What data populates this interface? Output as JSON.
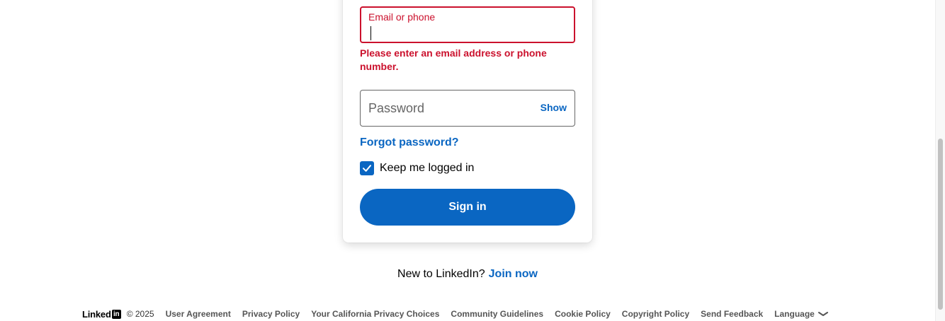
{
  "login_form": {
    "email_label": "Email or phone",
    "email_value": "",
    "email_error": "Please enter an email address or phone number.",
    "password_placeholder": "Password",
    "show_label": "Show",
    "forgot_password": "Forgot password?",
    "keep_logged_in_label": "Keep me logged in",
    "keep_logged_in_checked": true,
    "sign_in_label": "Sign in"
  },
  "join": {
    "prompt": "New to LinkedIn?",
    "link": "Join now"
  },
  "footer": {
    "logo_text": "Linked",
    "logo_badge": "in",
    "copyright": "© 2025",
    "links": [
      "User Agreement",
      "Privacy Policy",
      "Your California Privacy Choices",
      "Community Guidelines",
      "Cookie Policy",
      "Copyright Policy",
      "Send Feedback"
    ],
    "language_label": "Language"
  },
  "colors": {
    "accent": "#0a66c2",
    "error": "#cb112d"
  },
  "icons": {
    "checkbox": "checkmark-icon",
    "language": "chevron-down-icon",
    "logo": "linkedin-logo"
  }
}
